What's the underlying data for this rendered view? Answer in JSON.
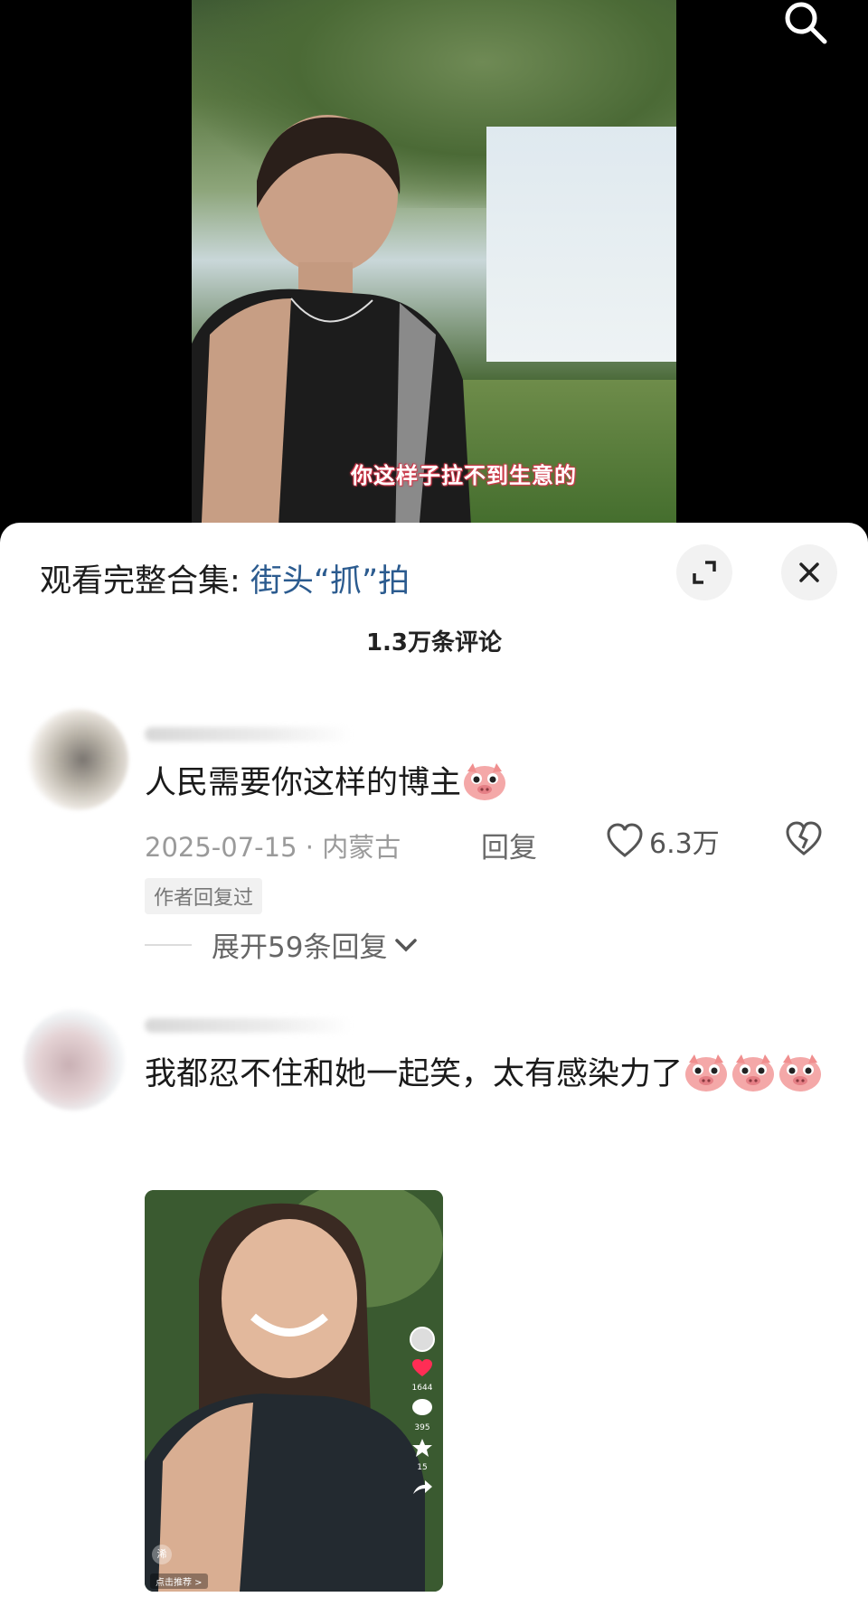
{
  "video": {
    "subtitle": "你这样子拉不到生意的"
  },
  "sheet": {
    "collection_prefix": "观看完整合集: ",
    "collection_link": "街头“抓”拍",
    "comment_count": "1.3万条评论"
  },
  "comments": [
    {
      "text": "人民需要你这样的博主",
      "date_location": "2025-07-15 · 内蒙古",
      "reply_label": "回复",
      "likes": "6.3万",
      "author_badge": "作者回复过",
      "expand_label": "展开59条回复"
    },
    {
      "text": "我都忍不住和她一起笑，太有感染力了"
    }
  ],
  "thumbnail": {
    "side_counts": [
      "1644",
      "395",
      "15"
    ],
    "bottom_label": "点击推荐 >",
    "corner_tag": "浠"
  },
  "icons": {
    "search": "search-icon",
    "expand": "fullscreen-icon",
    "close": "close-icon",
    "like": "heart-icon",
    "dislike": "broken-heart-icon",
    "chevron": "chevron-down-icon",
    "emoji": "pig-emoji-icon"
  },
  "colors": {
    "link": "#2b5b8f",
    "subtitle_outline": "#d13a4c"
  }
}
